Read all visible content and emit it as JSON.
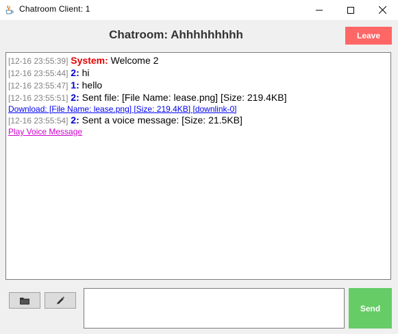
{
  "window": {
    "title": "Chatroom Client: 1",
    "app_icon": "java-cup-icon"
  },
  "header": {
    "room_title": "Chatroom: Ahhhhhhhhh",
    "leave_label": "Leave",
    "leave_color": "#ff6666"
  },
  "chat": {
    "messages": [
      {
        "timestamp": "[12-16 23:55:39]",
        "sender": "System:",
        "text": "Welcome 2"
      },
      {
        "timestamp": "[12-16 23:55:44]",
        "sender": "2:",
        "text": "hi"
      },
      {
        "timestamp": "[12-16 23:55:47]",
        "sender": "1:",
        "text": "hello"
      },
      {
        "timestamp": "[12-16 23:55:51]",
        "sender": "2:",
        "text": "Sent file: [File Name: lease.png] [Size: 219.4KB]"
      },
      {
        "timestamp": "[12-16 23:55:54]",
        "sender": "2:",
        "text": "Sent a voice message: [Size: 21.5KB]"
      }
    ],
    "download_link": "Download: [File Name: lease.png] [Size: 219.4KB] [downlink-0]",
    "voice_link": "Play Voice Message",
    "colors": {
      "system_sender": "#e60000",
      "user_sender": "#0000cc",
      "timestamp": "#808080",
      "download_link": "#0000ee",
      "voice_link": "#cc00cc"
    }
  },
  "composer": {
    "folder_icon": "folder-icon",
    "pen_icon": "pen-icon",
    "input_value": "",
    "send_label": "Send",
    "send_color": "#66cc66"
  }
}
